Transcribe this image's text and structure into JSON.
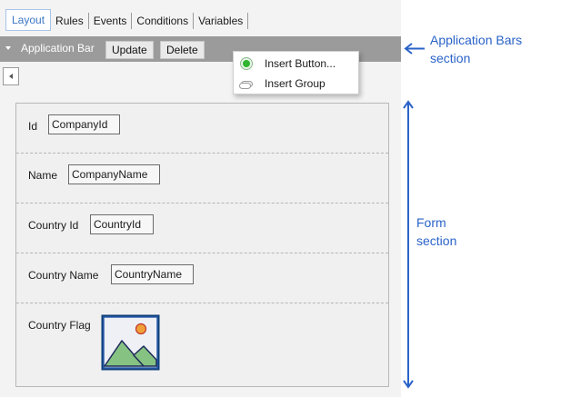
{
  "tabs": [
    {
      "label": "Layout",
      "active": true
    },
    {
      "label": "Rules",
      "active": false
    },
    {
      "label": "Events",
      "active": false
    },
    {
      "label": "Conditions",
      "active": false
    },
    {
      "label": "Variables",
      "active": false
    }
  ],
  "app_bar": {
    "title": "Application Bar",
    "update_label": "Update",
    "delete_label": "Delete"
  },
  "context_menu": {
    "items": [
      {
        "label": "Insert Button...",
        "icon": "green-radio-icon"
      },
      {
        "label": "Insert Group",
        "icon": "group-icon"
      }
    ]
  },
  "form": {
    "rows": [
      {
        "label": "Id",
        "value": "CompanyId"
      },
      {
        "label": "Name",
        "value": "CompanyName"
      },
      {
        "label": "Country Id",
        "value": "CountryId"
      },
      {
        "label": "Country Name",
        "value": "CountryName"
      },
      {
        "label": "Country Flag",
        "value": null
      }
    ]
  },
  "annotations": {
    "app_bars": {
      "line1": "Application Bars",
      "line2": "section"
    },
    "form": {
      "line1": "Form",
      "line2": "section"
    }
  },
  "colors": {
    "accent": "#2a63c8",
    "app_bar_bg": "#9b9b9b",
    "active_tab": "#3b76c4",
    "form_bg": "#f0f0f0"
  }
}
